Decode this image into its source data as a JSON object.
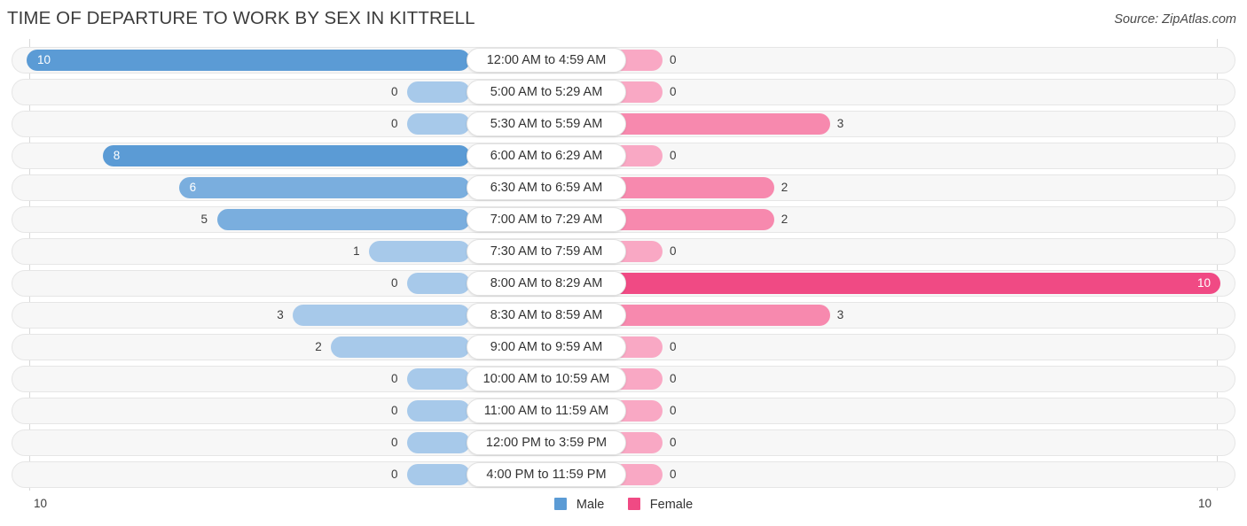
{
  "header": {
    "title": "TIME OF DEPARTURE TO WORK BY SEX IN KITTRELL",
    "source": "Source: ZipAtlas.com"
  },
  "legend": {
    "male_label": "Male",
    "female_label": "Female",
    "male_color": "#5b9bd5",
    "female_color": "#f04a84"
  },
  "axis": {
    "left_label": "10",
    "right_label": "10"
  },
  "chart_data": {
    "type": "bar",
    "title": "TIME OF DEPARTURE TO WORK BY SEX IN KITTRELL",
    "xlabel": "",
    "ylabel": "",
    "orientation": "horizontal-diverging",
    "grid": false,
    "legend_position": "bottom-center",
    "axis_max": 10,
    "xlim": [
      10,
      10
    ],
    "categories": [
      "12:00 AM to 4:59 AM",
      "5:00 AM to 5:29 AM",
      "5:30 AM to 5:59 AM",
      "6:00 AM to 6:29 AM",
      "6:30 AM to 6:59 AM",
      "7:00 AM to 7:29 AM",
      "7:30 AM to 7:59 AM",
      "8:00 AM to 8:29 AM",
      "8:30 AM to 8:59 AM",
      "9:00 AM to 9:59 AM",
      "10:00 AM to 10:59 AM",
      "11:00 AM to 11:59 AM",
      "12:00 PM to 3:59 PM",
      "4:00 PM to 11:59 PM"
    ],
    "series": [
      {
        "name": "Male",
        "side": "left",
        "color": "#5b9bd5",
        "values": [
          10,
          0,
          0,
          8,
          6,
          5,
          1,
          0,
          3,
          2,
          0,
          0,
          0,
          0
        ]
      },
      {
        "name": "Female",
        "side": "right",
        "color": "#f04a84",
        "values": [
          0,
          0,
          3,
          0,
          2,
          2,
          0,
          10,
          3,
          0,
          0,
          0,
          0,
          0
        ]
      }
    ]
  }
}
